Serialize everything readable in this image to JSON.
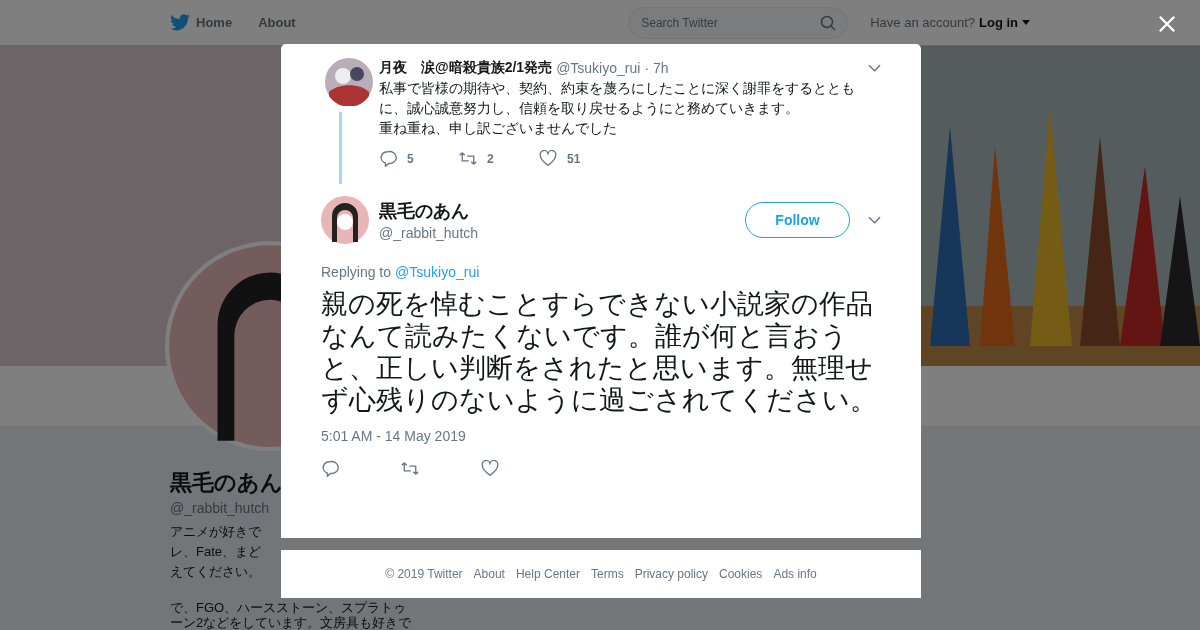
{
  "topbar": {
    "nav": [
      "Home",
      "About"
    ],
    "search": {
      "placeholder": "Search Twitter"
    },
    "account_prompt": "Have an account?",
    "login": "Log in"
  },
  "profile": {
    "name": "黒毛のあん",
    "handle": "@_rabbit_hutch",
    "bio_lines": [
      "アニメが好きで",
      "レ、Fate、まど",
      "えてください。",
      "で、FGO、ハースストーン、スプラトゥ",
      "ーン2などをしています。文房具も好きで"
    ]
  },
  "parent_tweet": {
    "name": "月夜　涙@暗殺貴族2/1発売",
    "handle": "@Tsukiyo_rui",
    "time": "· 7h",
    "paragraphs": [
      "私事で皆様の期待や、契約、約束を蔑ろにしたことに深く謝罪をするとともに、誠心誠意努力し、信頼を取り戻せるようにと務めていきます。",
      "重ね重ね、申し訳ございませんでした"
    ],
    "actions": [
      {
        "kind": "reply",
        "count": "5"
      },
      {
        "kind": "retweet",
        "count": "2"
      },
      {
        "kind": "like",
        "count": "51"
      }
    ]
  },
  "tweet": {
    "name": "黒毛のあん",
    "handle": "@_rabbit_hutch",
    "follow": "Follow",
    "replying_prefix": "Replying to",
    "replying_to": "@Tsukiyo_rui",
    "text": "親の死を悼むことすらできない小説家の作品なんて読みたくないです。誰が何と言おうと、正しい判断をされたと思います。無理せず心残りのないように過ごされてください。",
    "timestamp": "5:01 AM - 14 May 2019",
    "actions": [
      {
        "kind": "reply"
      },
      {
        "kind": "retweet"
      },
      {
        "kind": "like"
      }
    ]
  },
  "footer": [
    "© 2019 Twitter",
    "About",
    "Help Center",
    "Terms",
    "Privacy policy",
    "Cookies",
    "Ads info"
  ]
}
